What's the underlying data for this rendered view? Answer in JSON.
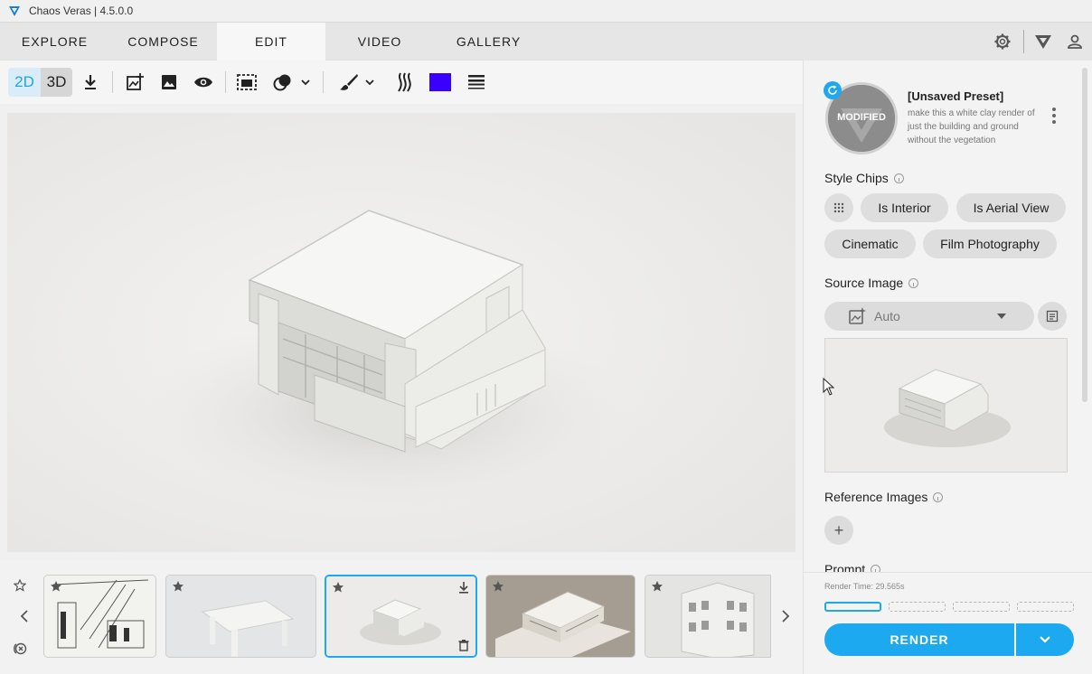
{
  "window": {
    "title": "Chaos Veras | 4.5.0.0"
  },
  "nav": {
    "tabs": [
      {
        "label": "EXPLORE"
      },
      {
        "label": "COMPOSE"
      },
      {
        "label": "EDIT"
      },
      {
        "label": "VIDEO"
      },
      {
        "label": "GALLERY"
      }
    ],
    "active_tab": "EDIT",
    "icons": [
      "gear-icon",
      "veras-logo-icon",
      "user-icon"
    ]
  },
  "toolbar": {
    "mode_2d": "2D",
    "mode_3d": "3D",
    "active_mode": "2D",
    "swatch_color": "#3a00ff",
    "icons": [
      "download-icon",
      "add-image-icon",
      "image-icon",
      "eye-icon",
      "crop-select-icon",
      "blend-icon",
      "brush-icon",
      "flame-icon",
      "color-swatch",
      "lines-icon"
    ]
  },
  "filmstrip": {
    "thumbnails": [
      {
        "subject": "sketch interior",
        "selected": false
      },
      {
        "subject": "white table",
        "selected": false
      },
      {
        "subject": "white clay house",
        "selected": true
      },
      {
        "subject": "terraced building",
        "selected": false
      },
      {
        "subject": "white facade",
        "selected": false
      }
    ]
  },
  "preset": {
    "badge": "MODIFIED",
    "name": "[Unsaved Preset]",
    "description": "make this a white clay render of just the building and ground without the vegetation"
  },
  "style_chips": {
    "label": "Style Chips",
    "chips": [
      "Is Interior",
      "Is Aerial View",
      "Cinematic",
      "Film Photography"
    ]
  },
  "source_image": {
    "label": "Source Image",
    "selected": "Auto"
  },
  "reference_images": {
    "label": "Reference Images",
    "add": "+"
  },
  "prompt": {
    "label": "Prompt"
  },
  "render": {
    "time_label": "Render Time: 29.565s",
    "button": "RENDER",
    "progress": [
      1,
      0,
      0,
      0
    ],
    "accent": "#1da9f0"
  }
}
